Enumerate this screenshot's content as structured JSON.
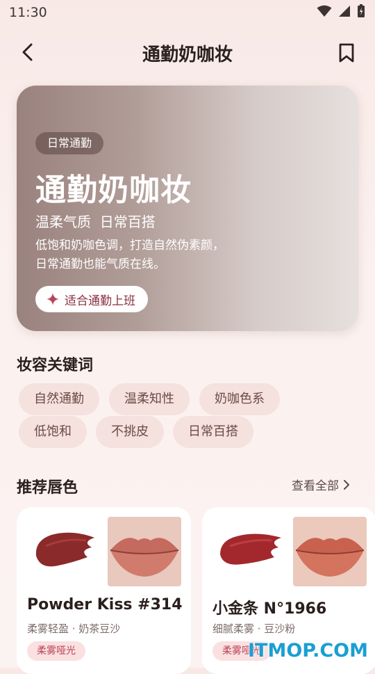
{
  "status_bar": {
    "time": "11:30"
  },
  "appbar": {
    "title": "通勤奶咖妆"
  },
  "hero": {
    "chip": "日常通勤",
    "title": "通勤奶咖妆",
    "subtitle": "温柔气质  日常百搭",
    "desc_line1": "低饱和奶咖色调，打造自然伪素颜，",
    "desc_line2": "日常通勤也能气质在线。",
    "fit_label": "适合通勤上班"
  },
  "keywords": {
    "title": "妆容关键词",
    "tags": [
      "自然通勤",
      "温柔知性",
      "奶咖色系",
      "低饱和",
      "不挑皮",
      "日常百搭"
    ]
  },
  "recommend": {
    "title": "推荐唇色",
    "see_all": "查看全部",
    "cards": [
      {
        "name": "Powder Kiss #314",
        "meta": "柔雾轻盈 · 奶茶豆沙",
        "badge": "柔雾哑光"
      },
      {
        "name": "小金条 N°1966",
        "meta": "细腻柔雾 · 豆沙粉",
        "badge": "柔雾哑光"
      }
    ]
  },
  "watermark": "ITMOP.COM",
  "colors": {
    "accent": "#b84456",
    "tag_bg": "#f5e1de",
    "hero_start": "#9a827e"
  }
}
